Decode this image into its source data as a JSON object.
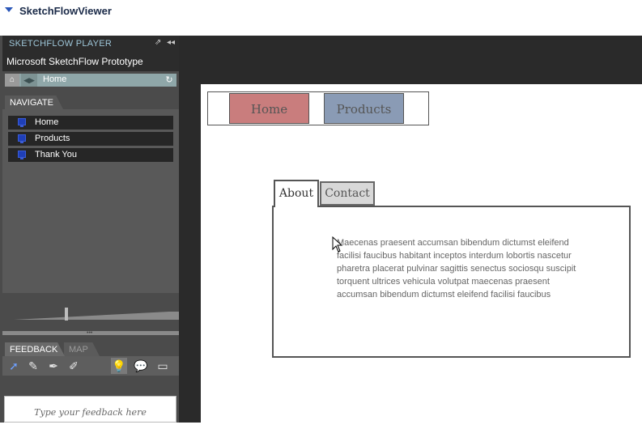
{
  "header": {
    "title": "SketchFlowViewer"
  },
  "player": {
    "title": "SKETCHFLOW PLAYER",
    "prototype_name": "Microsoft SketchFlow Prototype",
    "breadcrumb": "Home",
    "navigate_tab": "NAVIGATE",
    "nav_items": [
      {
        "label": "Home"
      },
      {
        "label": "Products"
      },
      {
        "label": "Thank You"
      }
    ],
    "feedback_tab": "FEEDBACK",
    "map_tab": "MAP",
    "feedback_placeholder": "Type your feedback here"
  },
  "canvas": {
    "menu": {
      "home": "Home",
      "products": "Products"
    },
    "tabs": {
      "about": "About",
      "contact": "Contact"
    },
    "body_text": "Maecenas praesent accumsan bibendum dictumst eleifend facilisi faucibus habitant inceptos interdum lobortis nascetur pharetra placerat pulvinar sagittis senectus sociosqu suscipit torquent ultrices vehicula volutpat maecenas praesent accumsan bibendum dictumst eleifend facilisi faucibus"
  },
  "colors": {
    "home_button": "#c97d7d",
    "products_button": "#8a9bb5",
    "player_bg": "#4b4b4b",
    "accent_title": "#9ec6d8"
  },
  "icons": [
    "collapse-arrow-icon",
    "popout-icon",
    "minimize-icon",
    "home-icon",
    "back-icon",
    "refresh-icon",
    "screen-icon",
    "pointer-icon",
    "brush-icon",
    "pen-icon",
    "eraser-icon",
    "lightbulb-icon",
    "comment-icon",
    "folder-icon"
  ]
}
